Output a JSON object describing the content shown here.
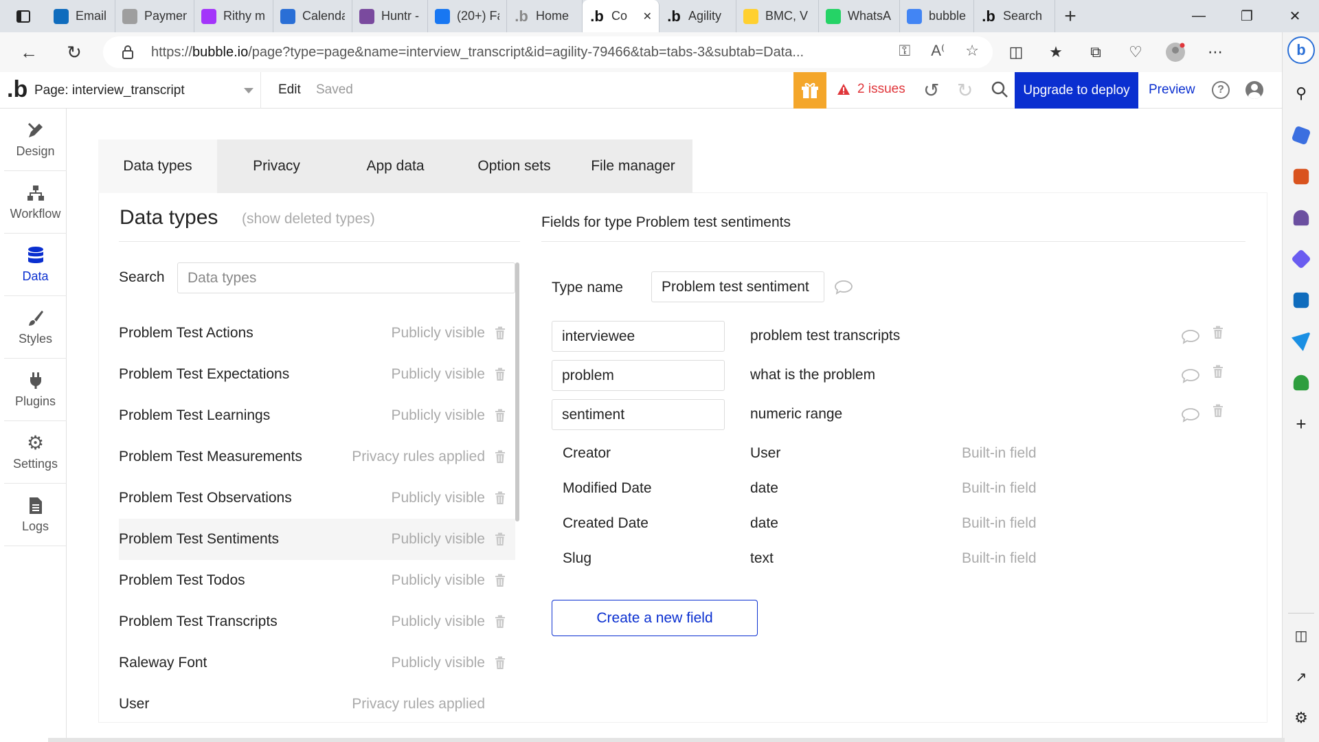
{
  "browser": {
    "tabs": [
      {
        "label": "Email - |",
        "favicon": "outlook",
        "color": "#0f6cbd"
      },
      {
        "label": "Paymen",
        "favicon": "payment",
        "color": "#9e9e9e"
      },
      {
        "label": "Rithy m",
        "favicon": "messenger",
        "color": "#a334fa"
      },
      {
        "label": "Calenda",
        "favicon": "calendar",
        "color": "#2a6fd6"
      },
      {
        "label": "Huntr -",
        "favicon": "huntr",
        "color": "#7a4a9e"
      },
      {
        "label": "(20+) Fa",
        "favicon": "facebook",
        "color": "#1877f2"
      },
      {
        "label": "Home",
        "favicon": "bubble",
        "color": "#888888"
      },
      {
        "label": "Co",
        "favicon": "bubble",
        "color": "#111111",
        "active": true
      },
      {
        "label": "Agility",
        "favicon": "bubble",
        "color": "#111111"
      },
      {
        "label": "BMC, V",
        "favicon": "miro",
        "color": "#ffd02f"
      },
      {
        "label": "WhatsA",
        "favicon": "whatsapp",
        "color": "#25d366"
      },
      {
        "label": "bubble",
        "favicon": "google",
        "color": "#4285f4"
      },
      {
        "label": "Search",
        "favicon": "bubble",
        "color": "#111111"
      }
    ],
    "url_prefix": "https://",
    "url_domain": "bubble.io",
    "url_rest": "/page?type=page&name=interview_transcript&id=agility-79466&tab=tabs-3&subtab=Data..."
  },
  "bubble_bar": {
    "page_label": "Page: interview_transcript",
    "edit": "Edit",
    "saved": "Saved",
    "issues": "2 issues",
    "upgrade": "Upgrade to deploy",
    "preview": "Preview",
    "help": "?"
  },
  "left_nav": [
    {
      "label": "Design",
      "icon": "design-icon"
    },
    {
      "label": "Workflow",
      "icon": "workflow-icon"
    },
    {
      "label": "Data",
      "icon": "data-icon",
      "active": true
    },
    {
      "label": "Styles",
      "icon": "styles-icon"
    },
    {
      "label": "Plugins",
      "icon": "plugins-icon"
    },
    {
      "label": "Settings",
      "icon": "settings-icon"
    },
    {
      "label": "Logs",
      "icon": "logs-icon"
    }
  ],
  "subtabs": [
    {
      "label": "Data types",
      "active": true
    },
    {
      "label": "Privacy"
    },
    {
      "label": "App data"
    },
    {
      "label": "Option sets"
    },
    {
      "label": "File manager"
    }
  ],
  "data_types": {
    "title": "Data types",
    "show_deleted": "(show deleted types)",
    "search_label": "Search",
    "search_placeholder": "Data types",
    "items": [
      {
        "name": "Problem Test Actions",
        "privacy": "Publicly visible"
      },
      {
        "name": "Problem Test Expectations",
        "privacy": "Publicly visible"
      },
      {
        "name": "Problem Test Learnings",
        "privacy": "Publicly visible"
      },
      {
        "name": "Problem Test Measurements",
        "privacy": "Privacy rules applied"
      },
      {
        "name": "Problem Test Observations",
        "privacy": "Publicly visible"
      },
      {
        "name": "Problem Test Sentiments",
        "privacy": "Publicly visible",
        "selected": true
      },
      {
        "name": "Problem Test Todos",
        "privacy": "Publicly visible"
      },
      {
        "name": "Problem Test Transcripts",
        "privacy": "Publicly visible"
      },
      {
        "name": "Raleway Font",
        "privacy": "Publicly visible"
      },
      {
        "name": "User",
        "privacy": "Privacy rules applied",
        "no_trash": true
      }
    ]
  },
  "fields_panel": {
    "title": "Fields for type Problem test sentiments",
    "type_name_label": "Type name",
    "type_name_value": "Problem test sentiment",
    "custom_fields": [
      {
        "name": "interviewee",
        "type": "problem test transcripts"
      },
      {
        "name": "problem",
        "type": "what is the problem"
      },
      {
        "name": "sentiment",
        "type": "numeric range"
      }
    ],
    "builtin_fields": [
      {
        "name": "Creator",
        "type": "User",
        "note": "Built-in field"
      },
      {
        "name": "Modified Date",
        "type": "date",
        "note": "Built-in field"
      },
      {
        "name": "Created Date",
        "type": "date",
        "note": "Built-in field"
      },
      {
        "name": "Slug",
        "type": "text",
        "note": "Built-in field"
      }
    ],
    "create_button": "Create a new field"
  },
  "colors": {
    "accent": "#0a2fd0",
    "issues": "#e0363b",
    "gift": "#f4a62a",
    "muted": "#aaaaaa"
  }
}
